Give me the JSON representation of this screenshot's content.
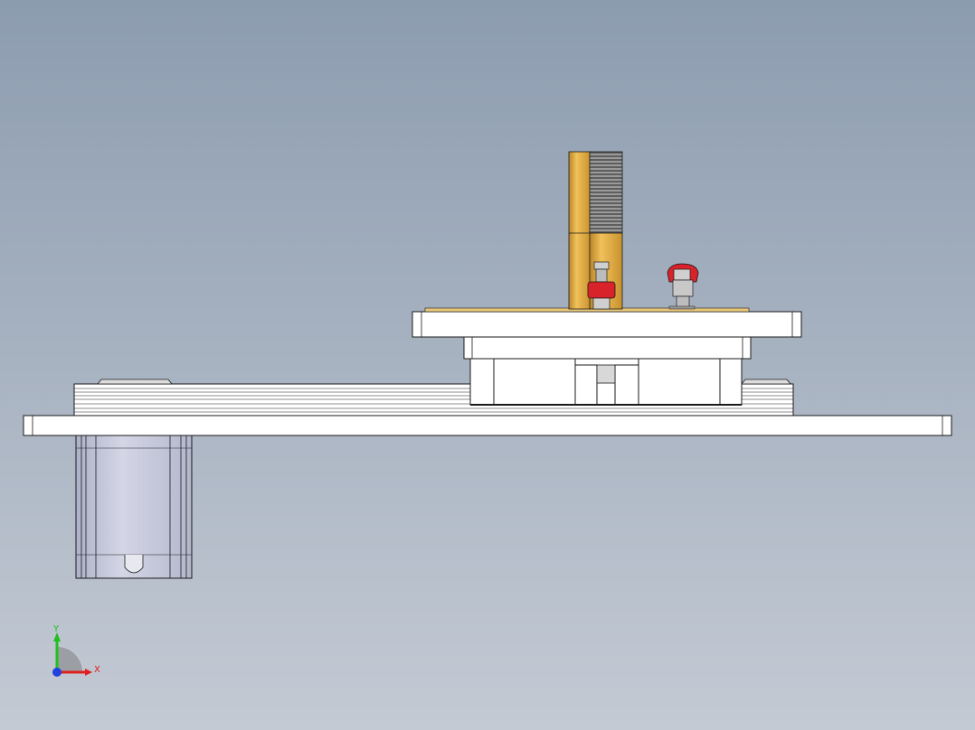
{
  "viewport": {
    "background_top": "#8c9caf",
    "background_bottom": "#c4cad4"
  },
  "model": {
    "part_colors": {
      "plate": "#ffffff",
      "edge": "#1a1a1a",
      "motor": "#c9ccdf",
      "sensor_gold": "#e0a83c",
      "thread_gray": "#8a8a8a",
      "clamp_red": "#d8232a",
      "bolt_gray": "#c8c8c8"
    },
    "parts": [
      {
        "name": "base-plate"
      },
      {
        "name": "linear-guide-rail"
      },
      {
        "name": "stepper-motor"
      },
      {
        "name": "slide-blocks"
      },
      {
        "name": "carriage-plate"
      },
      {
        "name": "top-plate"
      },
      {
        "name": "proximity-sensor"
      },
      {
        "name": "red-clamp-left"
      },
      {
        "name": "red-clamp-right"
      }
    ]
  },
  "triad": {
    "x_label": "X",
    "y_label": "Y",
    "x_color": "#e02020",
    "y_color": "#20c020",
    "z_color": "#2040e0"
  }
}
